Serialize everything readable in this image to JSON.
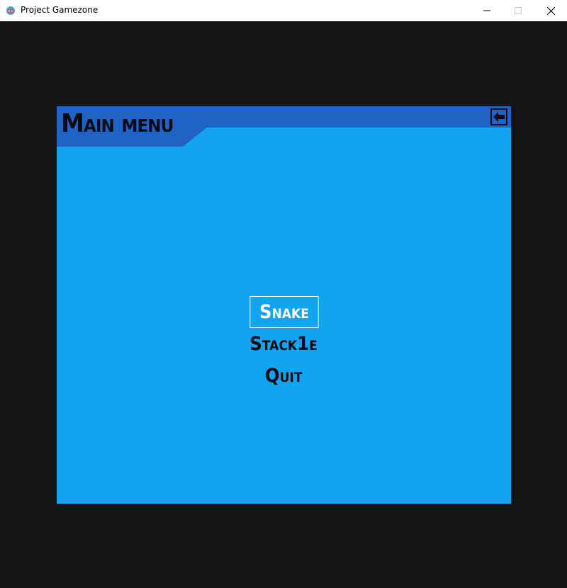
{
  "window": {
    "title": "Project Gamezone",
    "icon": "gamepad-icon",
    "controls": [
      "minimize-icon",
      "maximize-icon",
      "close-icon"
    ]
  },
  "panel": {
    "title": "Main menu",
    "back_icon": "arrow-left-icon",
    "colors": {
      "background": "#12a4ee",
      "header": "#1f63c6",
      "text": "#0a0a14",
      "selected": "#ffffff"
    }
  },
  "menu": {
    "items": [
      {
        "label": "Snake",
        "selected": true
      },
      {
        "label": "Stack1e",
        "selected": false
      },
      {
        "label": "Quit",
        "selected": false
      }
    ]
  }
}
